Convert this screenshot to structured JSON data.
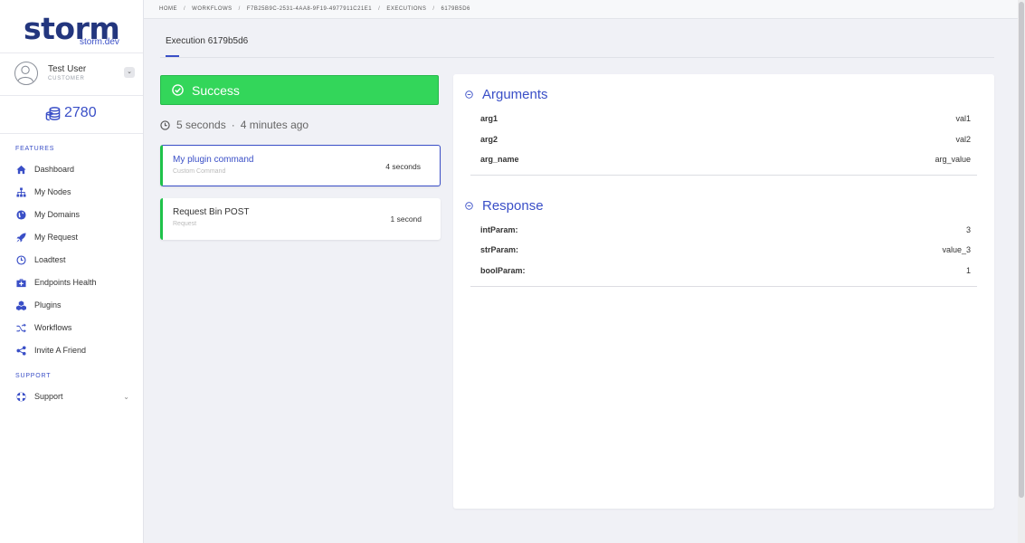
{
  "brand": {
    "name": "storm",
    "sub": "storm.dev",
    "color": "#23367e"
  },
  "user": {
    "name": "Test User",
    "role": "CUSTOMER",
    "toggle": "⌄"
  },
  "credits": {
    "value": "2780"
  },
  "sidebar": {
    "features_label": "FEATURES",
    "items": [
      {
        "label": "Dashboard",
        "icon": "home-icon"
      },
      {
        "label": "My Nodes",
        "icon": "sitemap-icon"
      },
      {
        "label": "My Domains",
        "icon": "globe-icon"
      },
      {
        "label": "My Request",
        "icon": "rocket-icon"
      },
      {
        "label": "Loadtest",
        "icon": "clock-icon"
      },
      {
        "label": "Endpoints Health",
        "icon": "medkit-icon"
      },
      {
        "label": "Plugins",
        "icon": "cubes-icon"
      },
      {
        "label": "Workflows",
        "icon": "random-icon"
      },
      {
        "label": "Invite A Friend",
        "icon": "share-icon"
      }
    ],
    "support_label": "SUPPORT",
    "support_item": {
      "label": "Support",
      "icon": "lifebuoy-icon",
      "chevron": "⌄"
    }
  },
  "breadcrumb": {
    "home": "HOME",
    "workflows": "WORKFLOWS",
    "workflow_id": "F7B25B9C-2531-4AA8-9F19-4977911C21E1",
    "executions": "EXECUTIONS",
    "execution_id": "6179B5D6",
    "separator": "/"
  },
  "tab": {
    "label": "Execution 6179b5d6"
  },
  "status": {
    "label": "Success",
    "color": "#33d65a"
  },
  "duration": {
    "elapsed": "5 seconds",
    "ago": "4 minutes ago",
    "dot": "·"
  },
  "commands": [
    {
      "title": "My plugin command",
      "type": "Custom Command",
      "time": "4 seconds",
      "active": true
    },
    {
      "title": "Request Bin POST",
      "type": "Request",
      "time": "1 second",
      "active": false
    }
  ],
  "arguments": {
    "title": "Arguments",
    "rows": [
      {
        "key": "arg1",
        "value": "val1"
      },
      {
        "key": "arg2",
        "value": "val2"
      },
      {
        "key": "arg_name",
        "value": "arg_value"
      }
    ]
  },
  "response": {
    "title": "Response",
    "rows": [
      {
        "key": "intParam:",
        "value": "3"
      },
      {
        "key": "strParam:",
        "value": "value_3"
      },
      {
        "key": "boolParam:",
        "value": "1"
      }
    ]
  },
  "colors": {
    "accent": "#3a4fc7",
    "success": "#1fc24a"
  }
}
